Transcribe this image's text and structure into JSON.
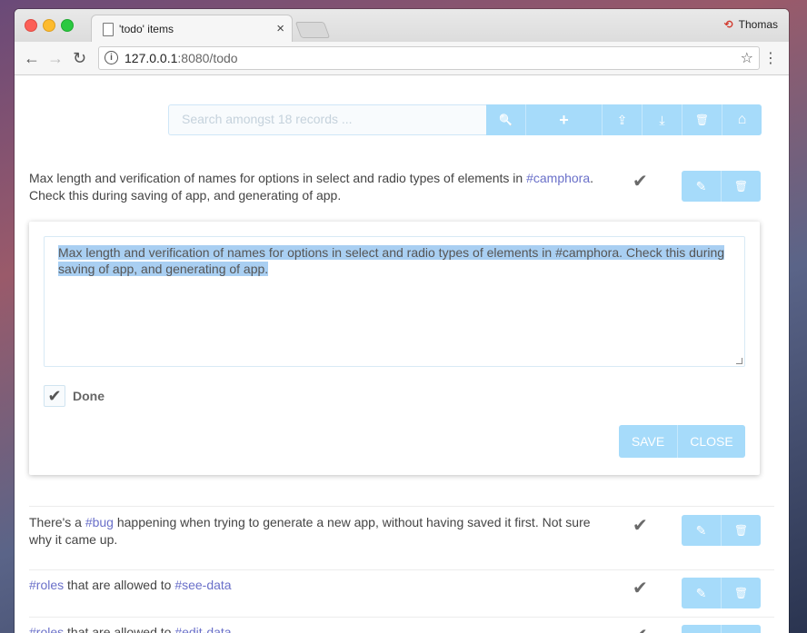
{
  "browser": {
    "tab_title": "'todo' items",
    "tab_close": "×",
    "profile_name": "Thomas",
    "profile_icon": "⟲",
    "url_host": "127.0.0.1",
    "url_rest": ":8080/todo",
    "back": "←",
    "forward": "→",
    "reload": "↻",
    "info": "i",
    "star": "☆",
    "menu": "⋮"
  },
  "search": {
    "placeholder": "Search amongst 18 records ..."
  },
  "toolbar_icons": {
    "search": "🔍",
    "add": "+",
    "upload": "⇪",
    "download": "⤓",
    "delete": "🗑",
    "home": "⌂"
  },
  "items": [
    {
      "before": "Max length and verification of names for options in select and radio types of elements in ",
      "tag": "#camphora",
      "after": ". Check this during saving of app, and generating of app."
    },
    {
      "before": "There's a ",
      "tag": "#bug",
      "after": " happening when trying to generate a new app, without having saved it first. Not sure why it came up."
    },
    {
      "tag": "#roles",
      "middle": " that are allowed to ",
      "tag2": "#see-data"
    },
    {
      "tag": "#roles",
      "middle": " that are allowed to ",
      "tag2": "#edit-data"
    }
  ],
  "row_icons": {
    "check": "✔",
    "edit": "✎",
    "delete": "🗑"
  },
  "editor": {
    "text": "Max length and verification of names for options in select and radio types of elements in #camphora. Check this during saving of app, and generating of app.",
    "done_check": "✔",
    "done_label": "Done",
    "save": "SAVE",
    "close": "CLOSE"
  }
}
